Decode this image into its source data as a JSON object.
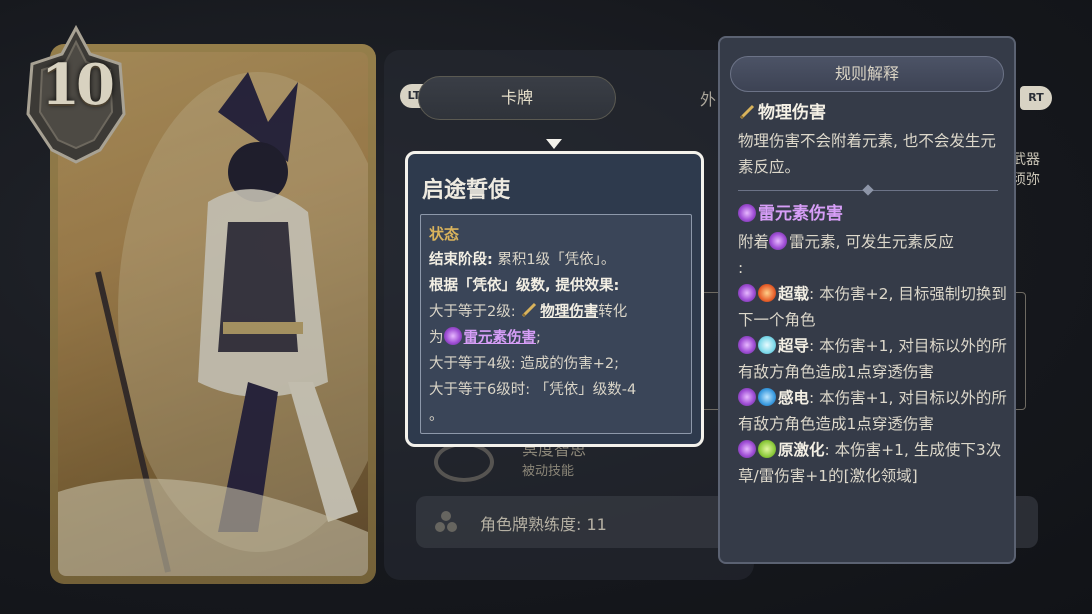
{
  "card": {
    "cost": "10"
  },
  "tabs": {
    "left_trigger": "LT",
    "card_tab": "卡牌",
    "other_tab": "外",
    "right_trigger": "RT"
  },
  "side_text": [
    "武器",
    "须弥"
  ],
  "skill": {
    "name": "冥度智思",
    "type": "被动技能"
  },
  "mastery": {
    "label": "角色牌熟练度: 11"
  },
  "status_tooltip": {
    "title": "启途誓使",
    "section": "状态",
    "lines": [
      {
        "bold": "结束阶段:",
        "text": " 累积1级「凭依」。"
      },
      {
        "bold": "根据「凭依」级数, 提供效果:",
        "text": ""
      }
    ],
    "level2_prefix": "大于等于2级: ",
    "level2_phys": "物理伤害",
    "level2_mid": "转化",
    "level2_for": "为",
    "level2_elec": "雷元素伤害",
    "level2_end": ";",
    "level4": "大于等于4级: 造成的伤害+2;",
    "level6": "大于等于6级时: 「凭依」级数-4",
    "level6_tail": "。"
  },
  "rule_tooltip": {
    "header": "规则解释",
    "phys_title": "物理伤害",
    "phys_desc": "物理伤害不会附着元素, 也不会发生元素反应。",
    "elec_title": "雷元素伤害",
    "elec_desc_pre": "附着",
    "elec_desc_post": "雷元素, 可发生元素反应",
    "elec_desc_tail": ":",
    "reactions": [
      {
        "name": "超载",
        "icon": "pyro",
        "desc": ": 本伤害+2, 目标强制切换到下一个角色"
      },
      {
        "name": "超导",
        "icon": "cryo",
        "desc": ": 本伤害+1, 对目标以外的所有敌方角色造成1点穿透伤害"
      },
      {
        "name": "感电",
        "icon": "hydro",
        "desc": ": 本伤害+1, 对目标以外的所有敌方角色造成1点穿透伤害"
      },
      {
        "name": "原激化",
        "icon": "dendro",
        "desc": ": 本伤害+1, 生成使下3次草/雷伤害+1的[激化领域]"
      }
    ]
  },
  "colors": {
    "electro": "#d79ef7",
    "gold": "#d9b35c",
    "tooltip_bg": "#2e3a4d"
  }
}
